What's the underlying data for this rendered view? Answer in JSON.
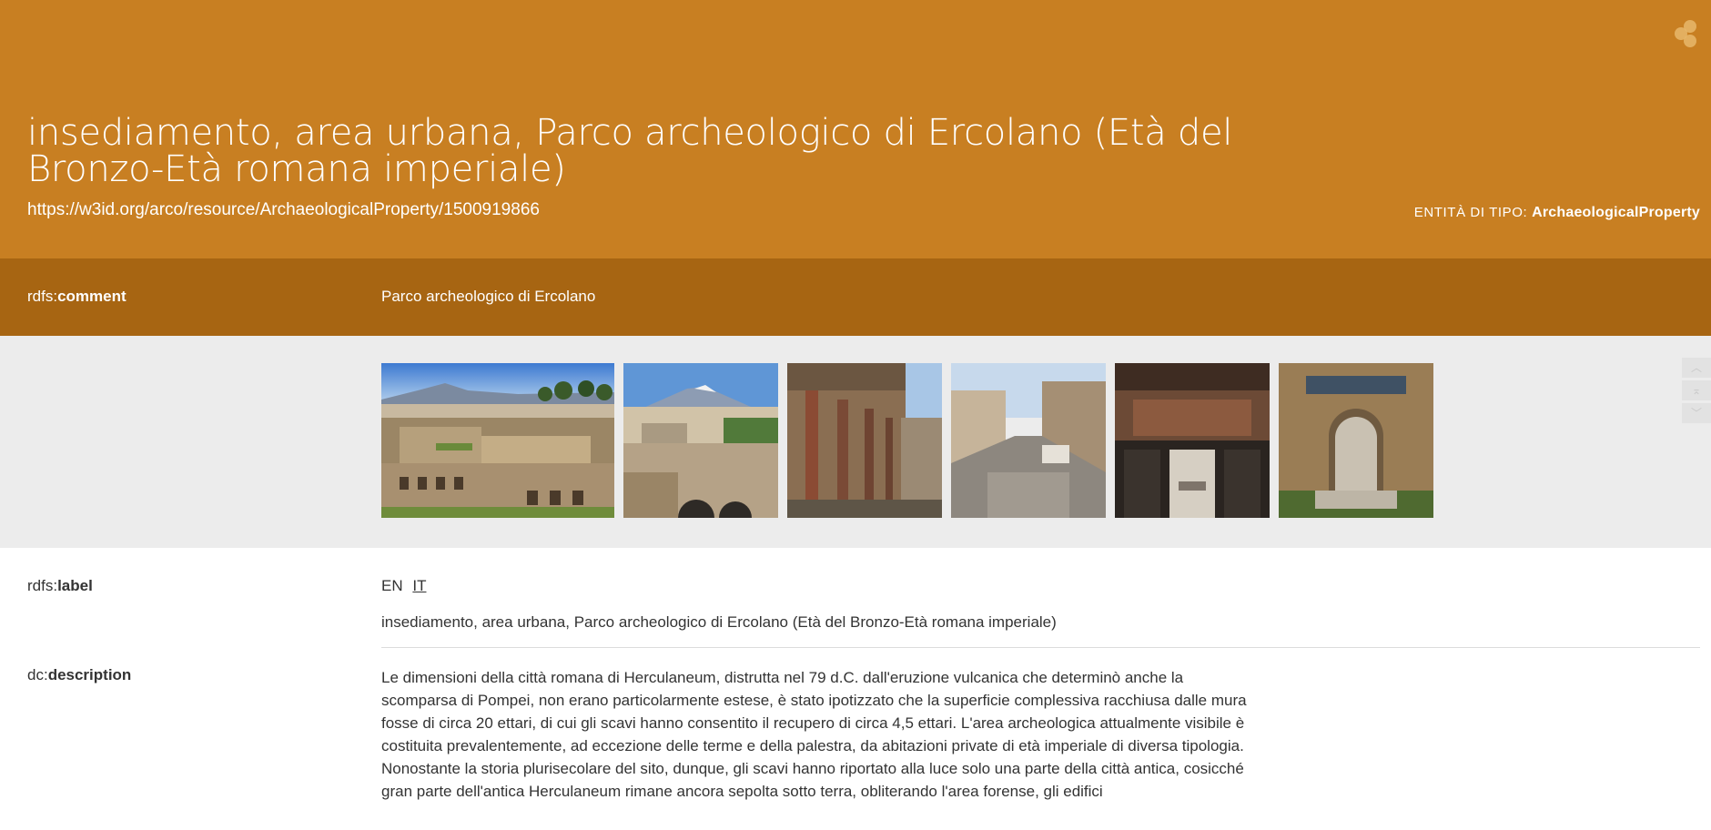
{
  "header": {
    "title": "insediamento, area urbana, Parco archeologico di Ercolano (Età del Bronzo-Età romana imperiale)",
    "uri": "https://w3id.org/arco/resource/ArchaeologicalProperty/1500919866",
    "entity_prefix": "ENTITÀ DI TIPO:",
    "entity_type": "ArchaeologicalProperty",
    "logo_icon": "dots-logo-icon"
  },
  "comment": {
    "prefix": "rdfs:",
    "property": "comment",
    "value": "Parco archeologico di Ercolano"
  },
  "gallery": {
    "images": [
      {
        "alt": "Parco archeologico di Ercolano"
      },
      {
        "alt": "Scavi con il Vesuvio"
      },
      {
        "alt": "Portico di casa"
      },
      {
        "alt": "Strada antica"
      },
      {
        "alt": "Interno di domus"
      },
      {
        "alt": "Nicchia affrescata"
      }
    ],
    "scroll_icons": [
      "chevron-up-icon",
      "scroll-top-icon",
      "chevron-down-icon"
    ]
  },
  "label": {
    "prefix": "rdfs:",
    "property": "label",
    "languages": [
      "EN",
      "IT"
    ],
    "active_language": "IT",
    "value": "insediamento, area urbana, Parco archeologico di Ercolano (Età del Bronzo-Età romana imperiale)"
  },
  "description": {
    "prefix": "dc:",
    "property": "description",
    "value": "Le dimensioni della città romana di Herculaneum, distrutta nel 79 d.C. dall'eruzione vulcanica che determinò anche la scomparsa di Pompei, non erano particolarmente estese, è stato ipotizzato che la superficie complessiva racchiusa dalle mura fosse di circa 20 ettari, di cui gli scavi hanno consentito il recupero di circa 4,5 ettari. L'area archeologica attualmente visibile è costituita prevalentemente, ad eccezione delle terme e della palestra, da abitazioni private di età imperiale di diversa tipologia. Nonostante la storia plurisecolare del sito, dunque, gli scavi hanno riportato alla luce solo una parte della città antica, cosicché gran parte dell'antica Herculaneum rimane ancora sepolta sotto terra, obliterando l'area forense, gli edifici"
  }
}
